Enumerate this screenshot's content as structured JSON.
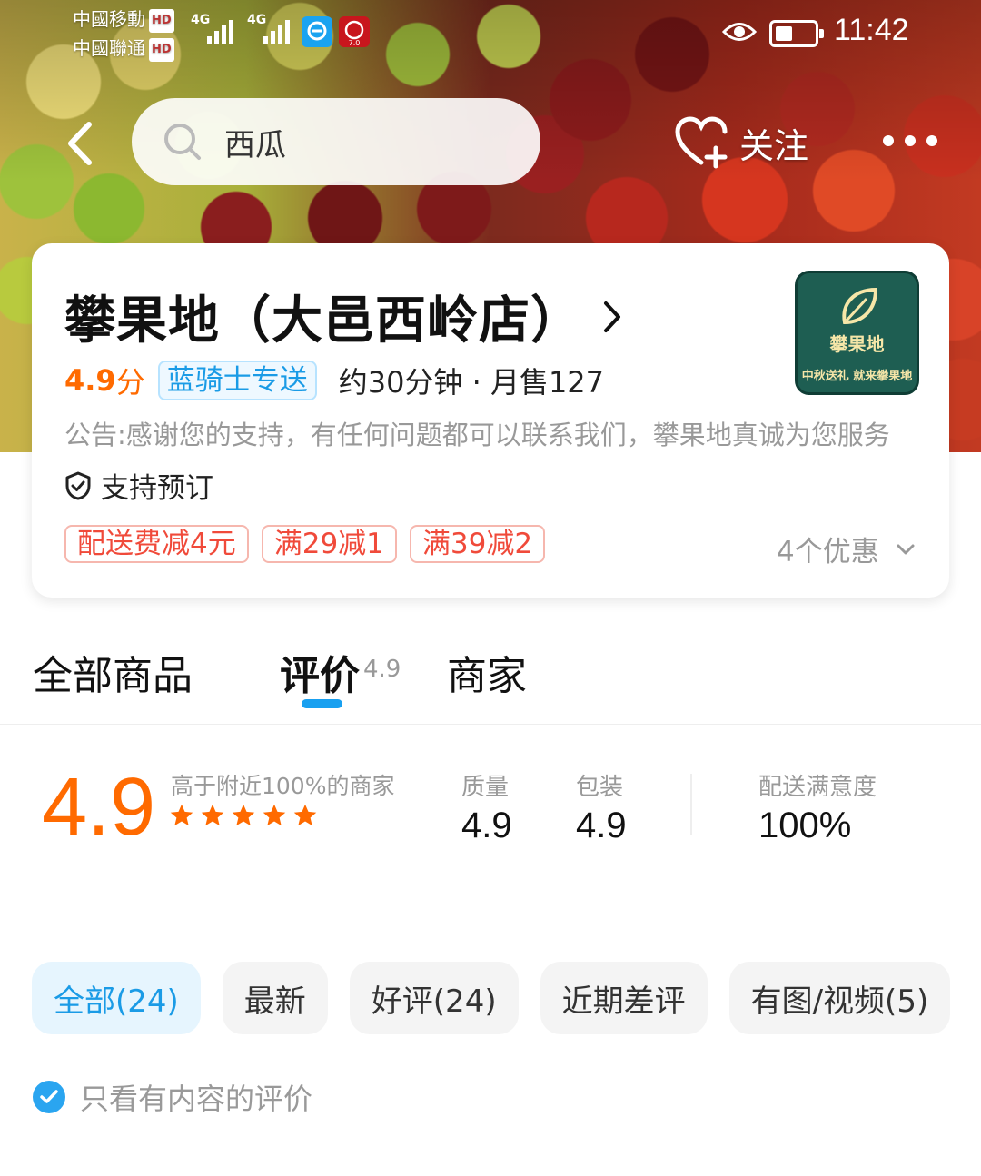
{
  "status_bar": {
    "carrier1": "中國移動",
    "carrier2": "中國聯通",
    "hd": "HD",
    "net": "4G",
    "app_badge_text": "7.0",
    "time": "11:42"
  },
  "header": {
    "search_text": "西瓜",
    "follow_label": "关注"
  },
  "shop": {
    "name": "攀果地（大邑西岭店）",
    "score": "4.9",
    "score_unit": "分",
    "delivery_tag": "蓝骑士专送",
    "eta_sales": "约30分钟 · 月售127",
    "notice": "公告:感谢您的支持，有任何问题都可以联系我们，攀果地真诚为您服务",
    "reserve_label": "支持预订",
    "logo_brand": "攀果地",
    "logo_footer": "中秋送礼 就来攀果地",
    "promos": [
      "配送费减4元",
      "满29减1",
      "满39减2"
    ],
    "promo_count": "4个优惠"
  },
  "tabs": {
    "all_goods": "全部商品",
    "reviews": "评价",
    "reviews_score": "4.9",
    "merchant": "商家"
  },
  "rating": {
    "overall": "4.9",
    "rank_text": "高于附近100%的商家",
    "stars": 5,
    "quality_label": "质量",
    "quality_value": "4.9",
    "packaging_label": "包装",
    "packaging_value": "4.9",
    "delivery_label": "配送满意度",
    "delivery_value": "100%"
  },
  "filters": [
    "全部(24)",
    "最新",
    "好评(24)",
    "近期差评",
    "有图/视频(5)"
  ],
  "content_only_label": "只看有内容的评价",
  "colors": {
    "accent_orange": "#ff6a00",
    "accent_blue": "#1a9be6",
    "promo_red": "#f04a3a"
  }
}
